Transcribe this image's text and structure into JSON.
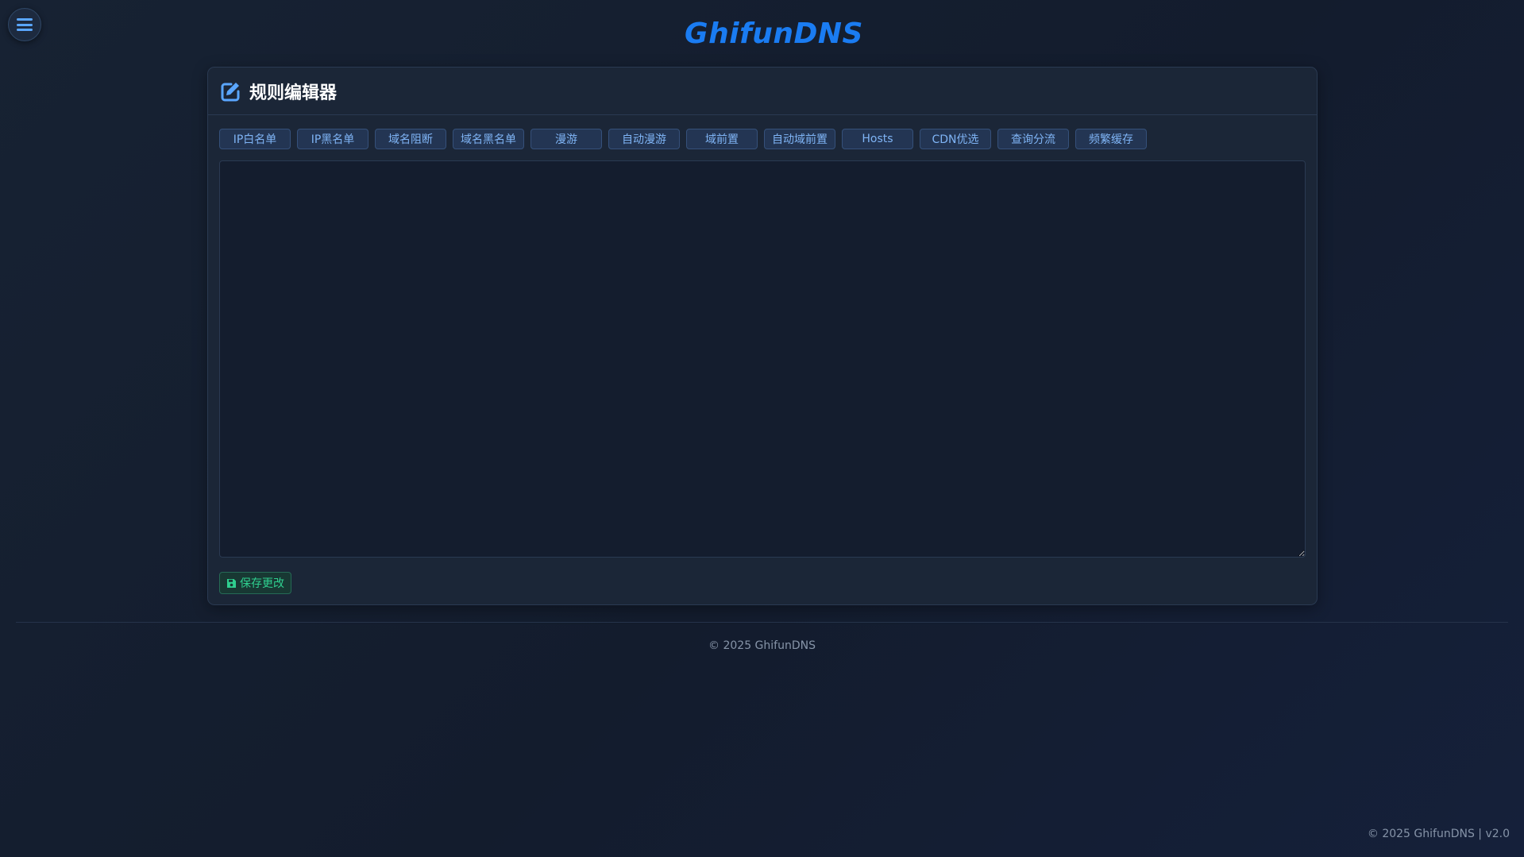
{
  "menu": {
    "icon": "hamburger-menu-icon"
  },
  "brand": {
    "title": "GhifunDNS",
    "color": "#1a7cf2"
  },
  "editor_card": {
    "icon": "edit-icon",
    "title": "规则编辑器",
    "tabs": [
      {
        "label": "IP白名单"
      },
      {
        "label": "IP黑名单"
      },
      {
        "label": "域名阻断"
      },
      {
        "label": "域名黑名单"
      },
      {
        "label": "漫游"
      },
      {
        "label": "自动漫游"
      },
      {
        "label": "域前置"
      },
      {
        "label": "自动域前置"
      },
      {
        "label": "Hosts"
      },
      {
        "label": "CDN优选"
      },
      {
        "label": "查询分流"
      },
      {
        "label": "频繁缓存"
      }
    ],
    "editor": {
      "value": "",
      "placeholder": ""
    },
    "save_button": {
      "label": "保存更改",
      "icon": "floppy-disk-icon"
    }
  },
  "footer": {
    "copyright": "© 2025 GhifunDNS",
    "version_text": "© 2025 GhifunDNS | v2.0"
  },
  "colors": {
    "accent": "#1a7cf2",
    "tab_text": "#7fb4f5",
    "save_text": "#2fcf8f",
    "background": "#172233"
  }
}
